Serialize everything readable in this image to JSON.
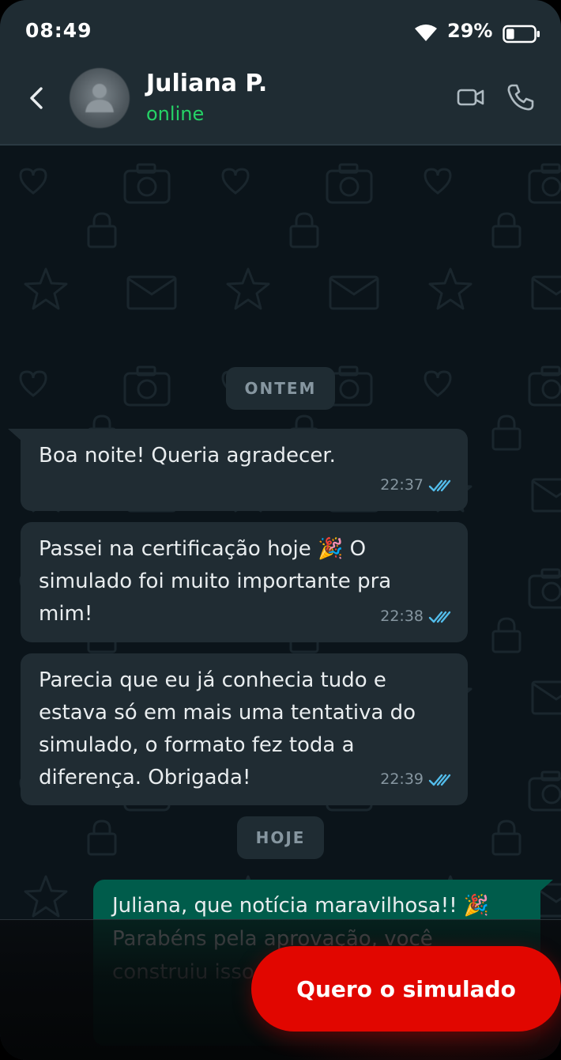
{
  "status_bar": {
    "time": "08:49",
    "battery_percent": "29%",
    "battery_level": 0.29,
    "wifi_icon": "wifi-icon",
    "battery_icon": "battery-icon"
  },
  "header": {
    "back_icon": "chevron-left-icon",
    "contact_name": "Juliana P.",
    "contact_status": "online",
    "video_icon": "video-camera-icon",
    "call_icon": "phone-icon"
  },
  "chat": {
    "date_separators": [
      "ONTEM",
      "HOJE"
    ],
    "incoming": [
      {
        "text": "Boa noite! Queria agradecer.",
        "time": "22:37",
        "ticks": "double-check-icon"
      },
      {
        "text": "Passei na certificação hoje 🎉 O simulado foi muito importante pra mim!",
        "time": "22:38",
        "ticks": "double-check-icon"
      },
      {
        "text": "Parecia que eu já conhecia tudo e estava só em mais uma tentativa do simulado, o formato fez toda a diferença. Obrigada!",
        "time": "22:39",
        "ticks": "double-check-icon"
      }
    ],
    "outgoing": [
      {
        "text": "Juliana, que notícia maravilhosa!! 🎉 Parabéns pela aprovação, você construiu isso. Sucesso na nova fase!"
      }
    ]
  },
  "cta": {
    "label": "Quero o simulado"
  },
  "colors": {
    "header_bg": "#1f2c33",
    "chat_bg": "#0b141a",
    "bubble_in": "#202c33",
    "bubble_out": "#005c4b",
    "online": "#25d366",
    "read_ticks": "#53bdeb",
    "cta": "#e10600"
  }
}
